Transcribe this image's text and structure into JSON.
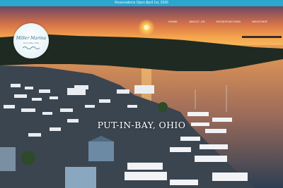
{
  "announcement": {
    "text": "Reservations Open April 1st, 2026"
  },
  "brand": {
    "logo_text": "Miller Marina",
    "logo_sub": "Put-in-Bay, Ohio"
  },
  "nav": {
    "items": [
      "HOME",
      "ABOUT US",
      "RESERVATIONS",
      "WEATHER"
    ]
  },
  "hero": {
    "headline": "PUT-IN-BAY, OHIO"
  },
  "colors": {
    "announcement_bar": "#2aa6cf",
    "sky_top": "#7a4a5f",
    "sun": "#ffcf57",
    "water": "#2d3f53"
  }
}
